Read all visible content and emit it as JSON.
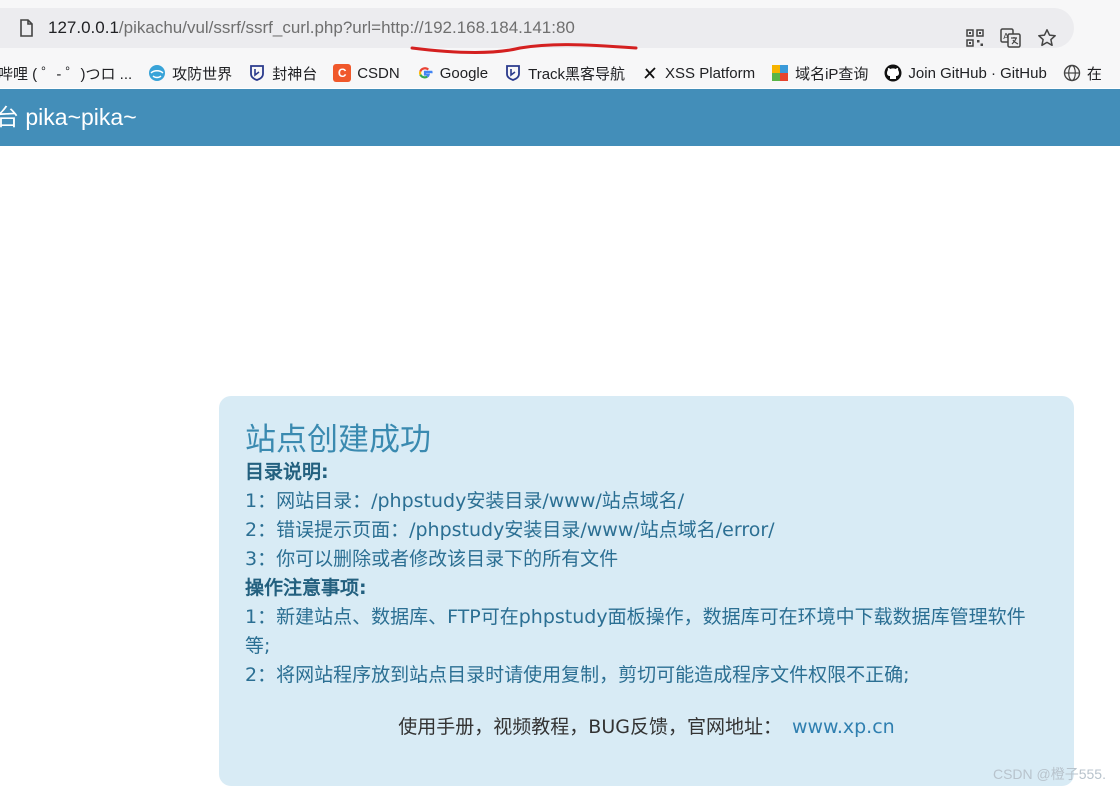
{
  "address_bar": {
    "url_host": "127.0.0.1",
    "url_path": "/pikachu/vul/ssrf/ssrf_curl.php?url=http://192.168.184.141:80"
  },
  "bookmarks": [
    {
      "label": "哔哩 ( ゜- ゜)つロ ...",
      "icon": "bilibili-icon"
    },
    {
      "label": "攻防世界",
      "icon": "globe-blue-icon"
    },
    {
      "label": "封神台",
      "icon": "shield-icon"
    },
    {
      "label": "CSDN",
      "icon": "csdn-icon"
    },
    {
      "label": "Google",
      "icon": "google-icon"
    },
    {
      "label": "Track黑客导航",
      "icon": "shield-icon"
    },
    {
      "label": "XSS Platform",
      "icon": "x-icon"
    },
    {
      "label": "域名iP查询",
      "icon": "puzzle-icon"
    },
    {
      "label": "Join GitHub · GitHub",
      "icon": "github-icon"
    },
    {
      "label": "在",
      "icon": "globe-icon"
    }
  ],
  "header": {
    "title": "台 pika~pika~"
  },
  "panel": {
    "heading": "站点创建成功",
    "section1_title": "目录说明:",
    "section1_items": [
      "1：网站目录：/phpstudy安装目录/www/站点域名/",
      "2：错误提示页面：/phpstudy安装目录/www/站点域名/error/",
      "3：你可以删除或者修改该目录下的所有文件"
    ],
    "section2_title": "操作注意事项:",
    "section2_items": [
      "1：新建站点、数据库、FTP可在phpstudy面板操作，数据库可在环境中下载数据库管理软件等;",
      "2：将网站程序放到站点目录时请使用复制，剪切可能造成程序文件权限不正确;"
    ],
    "footer_text": "使用手册，视频教程，BUG反馈，官网地址：",
    "footer_link": "www.xp.cn"
  },
  "watermark": "CSDN @橙子555.",
  "colors": {
    "header_bg": "#438eb9",
    "panel_bg": "#d8ebf5",
    "annotation_red": "#d42020"
  }
}
